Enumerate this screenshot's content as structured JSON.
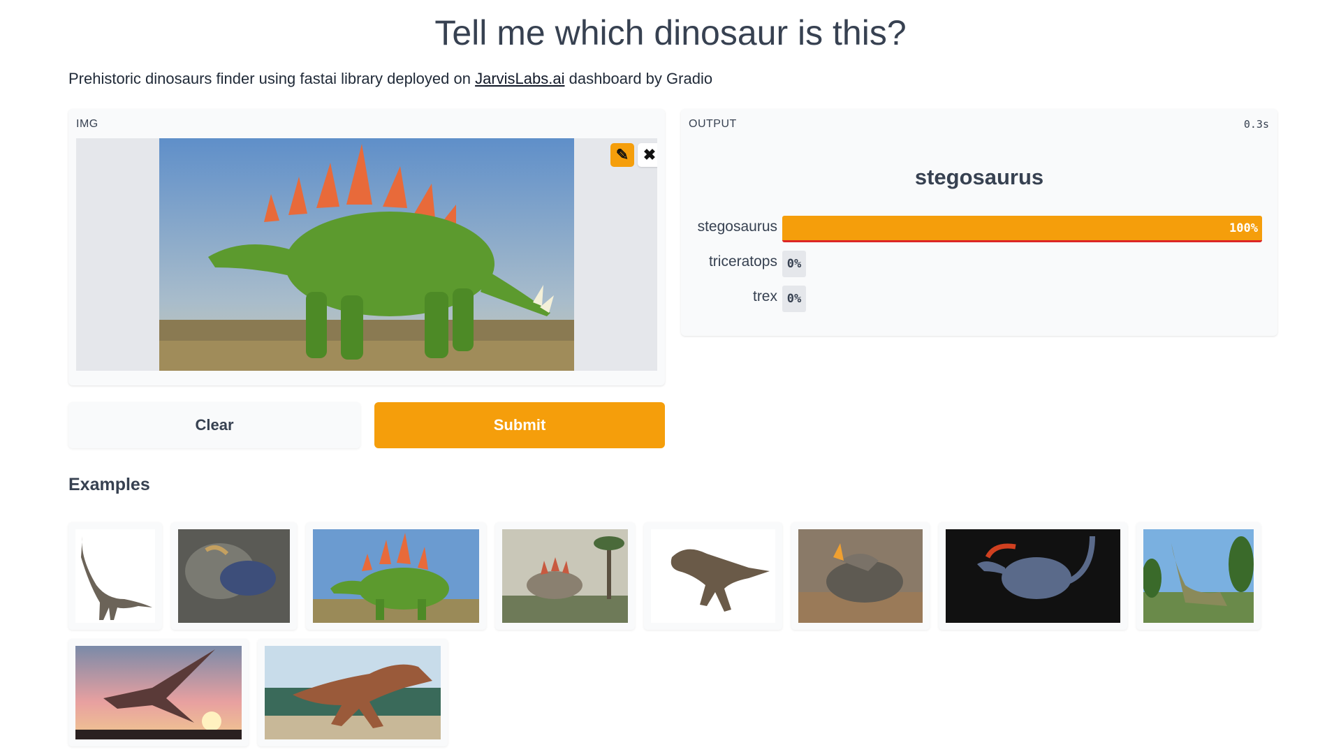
{
  "header": {
    "title": "Tell me which dinosaur is this?",
    "subtitle_before": "Prehistoric dinosaurs finder using fastai library deployed on ",
    "subtitle_link": "JarvisLabs.ai",
    "subtitle_after": " dashboard by Gradio"
  },
  "input": {
    "label": "IMG",
    "edit_icon": "pencil-icon",
    "close_icon": "close-icon"
  },
  "output": {
    "label": "OUTPUT",
    "time": "0.3s",
    "prediction": "stegosaurus",
    "confidences": [
      {
        "label": "stegosaurus",
        "value": 1.0,
        "text": "100%"
      },
      {
        "label": "triceratops",
        "value": 0.0,
        "text": "0%"
      },
      {
        "label": "trex",
        "value": 0.0,
        "text": "0%"
      }
    ]
  },
  "buttons": {
    "clear": "Clear",
    "submit": "Submit"
  },
  "examples": {
    "title": "Examples"
  },
  "colors": {
    "accent": "#f59e0b",
    "bar_underline": "#dc2626",
    "panel_bg": "#f9fafb"
  }
}
